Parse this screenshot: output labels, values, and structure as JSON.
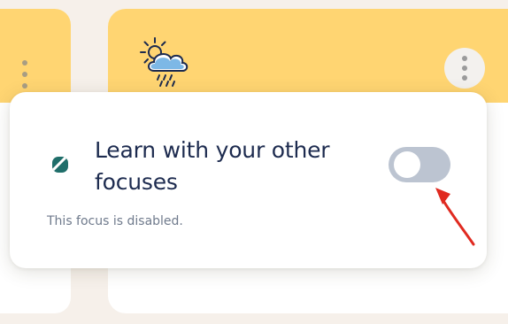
{
  "focus_setting": {
    "title": "Learn with your other focuses",
    "status_text": "This focus is disabled.",
    "toggle_enabled": false,
    "icon": "striped-leaf-icon"
  },
  "cards": {
    "left_card_menu_icon": "more-vertical-icon",
    "main_card_weather_icon": "sun-cloud-rain-icon",
    "main_card_menu_icon": "more-vertical-icon"
  },
  "colors": {
    "card_band": "#ffd572",
    "title_text": "#1d2b4f",
    "status_text": "#6f7a8c",
    "toggle_off": "#bcc4d1",
    "annotation_arrow": "#e02a20",
    "focus_icon": "#1f6e6a"
  }
}
